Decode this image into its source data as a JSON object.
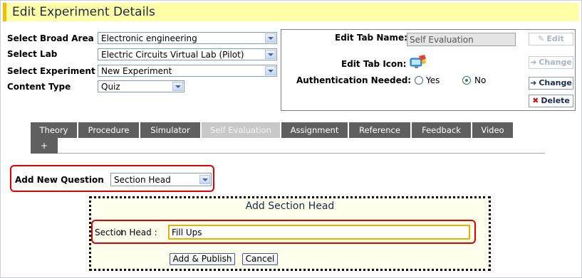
{
  "header": {
    "title": "Edit Experiment Details"
  },
  "form": {
    "broad_area": {
      "label": "Select Broad Area",
      "value": "Electronic engineering"
    },
    "lab": {
      "label": "Select Lab",
      "value": "Electric Circuits Virtual Lab (Pilot)"
    },
    "experiment": {
      "label": "Select Experiment",
      "value": "New Experiment"
    },
    "content_type": {
      "label": "Content Type",
      "value": "Quiz"
    }
  },
  "tab_panel": {
    "edit_tab_name_label": "Edit Tab Name:",
    "edit_tab_name_value": "Self Evaluation",
    "edit_tab_icon_label": "Edit Tab Icon:",
    "auth_label": "Authentication Needed:",
    "auth_yes": "Yes",
    "auth_no": "No",
    "auth_selected": "No",
    "edit_button": "Edit",
    "change_button_disabled": "Change",
    "change_button": "Change",
    "delete_button": "Delete"
  },
  "tabs": [
    {
      "label": "Theory",
      "active": false
    },
    {
      "label": "Procedure",
      "active": false
    },
    {
      "label": "Simulator",
      "active": false
    },
    {
      "label": "Self Evaluation",
      "active": true
    },
    {
      "label": "Assignment",
      "active": false
    },
    {
      "label": "Reference",
      "active": false
    },
    {
      "label": "Feedback",
      "active": false
    },
    {
      "label": "Video",
      "active": false
    }
  ],
  "add_tab_label": "+",
  "question": {
    "label": "Add New Question",
    "value": "Section Head"
  },
  "section_dialog": {
    "title": "Add Section Head",
    "field_label": "Section Head :",
    "field_value": "Fill Ups",
    "publish_button": "Add & Publish",
    "cancel_button": "Cancel"
  },
  "colors": {
    "header_bg": "#ffffa8",
    "header_accent": "#f0c000",
    "highlight": "#e00000",
    "tab_bg": "#5f5f5f",
    "tab_active_bg": "#c8c8c8"
  }
}
